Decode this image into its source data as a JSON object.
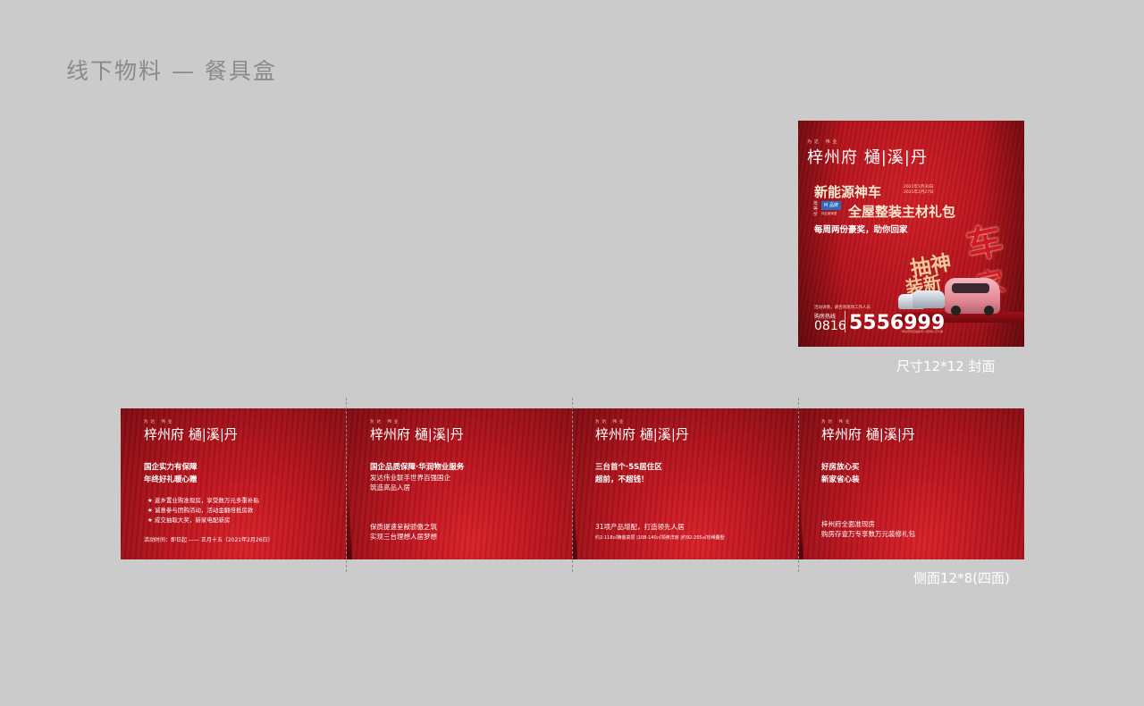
{
  "page_title": "线下物料 — 餐具盒",
  "cover": {
    "brand_small": "为达 伟业",
    "brand": "梓州府 樋|溪|丹",
    "headline1": "新能源神车",
    "dates": [
      "2021年1月30日",
      "2021年2月27日"
    ],
    "side_label": "抵等价",
    "chip_label": "M 品牌",
    "chip_caption": "伟业新家居",
    "headline2": "全屋整装主材礼包",
    "subline": "每周两份豪奖，助你回家",
    "art_text1": "抽神",
    "art_text2": "装新",
    "art_text3": "车",
    "art_text4": "家",
    "hotline_note": "活动详情，请咨询现场工作人员",
    "hotline_label": "购房热线",
    "area_code": "0816",
    "phone": "5556999",
    "fineprint": "梓州府项目备案号   以现场公示为准",
    "caption": "尺寸12*12    封面"
  },
  "side": {
    "caption": "侧面12*8(四面)",
    "panels": [
      {
        "brand_small": "为达 伟业",
        "brand": "梓州府 樋|溪|丹",
        "heading": [
          "国企实力有保障",
          "年终好礼暖心赠"
        ],
        "bullets": [
          "★ 返乡置业购准现房，享受数万元多重补贴",
          "★ 诚意参与团购活动，活动金翻倍抵房款",
          "★ 成交抽取大奖，新家电配新房"
        ],
        "footer": "活动时间：即日起 —— 正月十五（2021年2月26日）"
      },
      {
        "brand_small": "为达 伟业",
        "brand": "梓州府 樋|溪|丹",
        "heading": [
          "国企品质保障·华润物业服务"
        ],
        "lines": [
          "发达伟业联手世界百强国企",
          "筑造高品人居"
        ],
        "lines2": [
          "保质提速呈献骄傲之筑",
          "实现三台理想人居梦想"
        ]
      },
      {
        "brand_small": "为达 伟业",
        "brand": "梓州府 樋|溪|丹",
        "heading": [
          "三台首个·5S居住区",
          "超前，不超钱！"
        ],
        "line": "31项产品增配，打造领先人居",
        "small": "约2-118㎡精装高层  |108-140㎡领英洋房  |约92-205㎡珍稀叠墅"
      },
      {
        "brand_small": "为达 伟业",
        "brand": "梓州府 樋|溪|丹",
        "heading": [
          "好房放心买",
          "新家省心装"
        ],
        "lines": [
          "梓州府全面准现房",
          "购房存壹万专享数万元装修礼包"
        ]
      }
    ]
  }
}
